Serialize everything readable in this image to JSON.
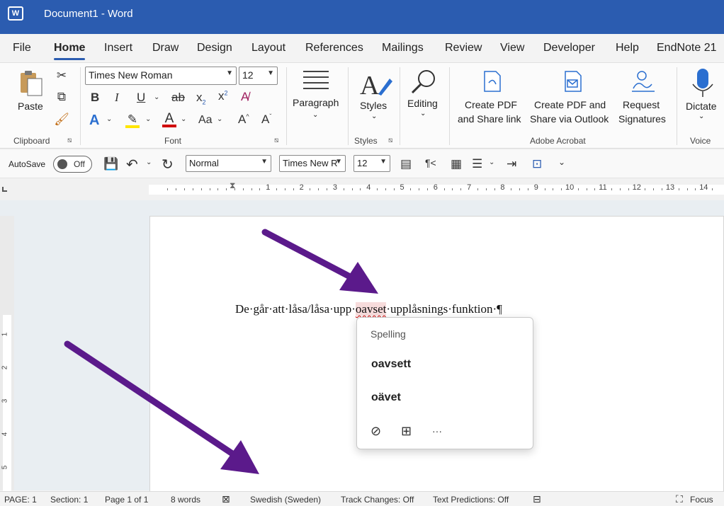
{
  "titlebar": {
    "logo": "W",
    "title": "Document1  -  Word"
  },
  "tabs": [
    "File",
    "Home",
    "Insert",
    "Draw",
    "Design",
    "Layout",
    "References",
    "Mailings",
    "Review",
    "View",
    "Developer",
    "Help",
    "EndNote 21"
  ],
  "ribbon": {
    "clipboard": {
      "paste": "Paste",
      "group": "Clipboard"
    },
    "font": {
      "family": "Times New Roman",
      "size": "12",
      "group": "Font"
    },
    "paragraph": {
      "label": "Paragraph"
    },
    "styles": {
      "label": "Styles",
      "group": "Styles"
    },
    "editing": {
      "label": "Editing"
    },
    "acrobat": {
      "create_pdf_line1": "Create PDF",
      "create_pdf_line2": "and Share link",
      "create_pdf_outlook_line1": "Create PDF and",
      "create_pdf_outlook_line2": "Share via Outlook",
      "request_line1": "Request",
      "request_line2": "Signatures",
      "group": "Adobe Acrobat"
    },
    "voice": {
      "dictate": "Dictate",
      "group": "Voice"
    }
  },
  "qat": {
    "autosave": "AutoSave",
    "toggle": "Off",
    "style": "Normal",
    "font": "Times New R",
    "size": "12"
  },
  "ruler": {
    "numbers": [
      "1",
      "2",
      "3",
      "4",
      "5",
      "6",
      "7",
      "8",
      "9",
      "10",
      "11",
      "12",
      "13",
      "14"
    ]
  },
  "vruler": {
    "numbers": [
      "1",
      "2",
      "3",
      "4",
      "5"
    ]
  },
  "document": {
    "before": "De·går·att·låsa/låsa·upp·",
    "misspelled": "oavset",
    "after": "·upplåsnings·funktion·¶"
  },
  "popup": {
    "heading": "Spelling",
    "suggestions": [
      "oavsett",
      "oävet"
    ],
    "more": "···"
  },
  "statusbar": {
    "page": "PAGE: 1",
    "section": "Section: 1",
    "page_of": "Page 1 of 1",
    "words": "8 words",
    "language": "Swedish (Sweden)",
    "track_changes": "Track Changes: Off",
    "text_predictions": "Text Predictions: Off",
    "focus": "Focus"
  },
  "colors": {
    "title_bar": "#2b5cb0",
    "arrow": "#5b1a8b",
    "misspell_highlight": "#f7dcdc"
  },
  "icons": [
    "word-logo-icon",
    "paste-icon",
    "cut-icon",
    "copy-icon",
    "format-painter-icon",
    "bold-icon",
    "italic-icon",
    "underline-icon",
    "strikethrough-icon",
    "subscript-icon",
    "superscript-icon",
    "clear-formatting-icon",
    "text-effects-icon",
    "highlight-icon",
    "font-color-icon",
    "change-case-icon",
    "grow-font-icon",
    "shrink-font-icon",
    "paragraph-icon",
    "styles-icon",
    "search-icon",
    "pdf-share-icon",
    "pdf-outlook-icon",
    "signature-icon",
    "microphone-icon",
    "save-icon",
    "undo-icon",
    "redo-icon",
    "ignore-icon",
    "add-dictionary-icon",
    "focus-icon"
  ]
}
